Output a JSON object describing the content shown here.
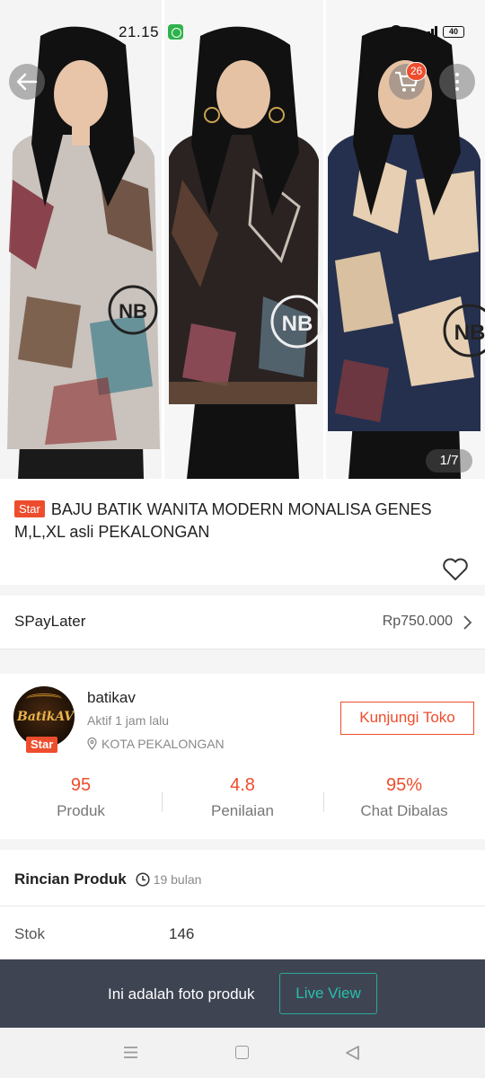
{
  "status_bar": {
    "time": "21.15",
    "network": "4G",
    "battery": "40"
  },
  "hero": {
    "cart_count": "26",
    "photo_counter": "1/7",
    "watermark": "NB"
  },
  "product": {
    "badge": "Star",
    "title": "BAJU BATIK WANITA MODERN MONALISA GENES M,L,XL asli PEKALONGAN"
  },
  "spaylater": {
    "label": "SPayLater",
    "value": "Rp750.000"
  },
  "shop": {
    "avatar_text": "BatikAV",
    "badge": "Star",
    "name": "batikav",
    "active": "Aktif 1 jam lalu",
    "location": "KOTA PEKALONGAN",
    "visit_label": "Kunjungi Toko",
    "stats": [
      {
        "value": "95",
        "label": "Produk"
      },
      {
        "value": "4.8",
        "label": "Penilaian"
      },
      {
        "value": "95%",
        "label": "Chat Dibalas"
      }
    ]
  },
  "details": {
    "title": "Rincian Produk",
    "duration": "19 bulan",
    "stock_label": "Stok",
    "stock_value": "146"
  },
  "live": {
    "text": "Ini adalah foto produk",
    "button": "Live View"
  },
  "colors": {
    "accent": "#ee4d2d",
    "teal": "#26aa99",
    "overlay": "#3f4453"
  }
}
